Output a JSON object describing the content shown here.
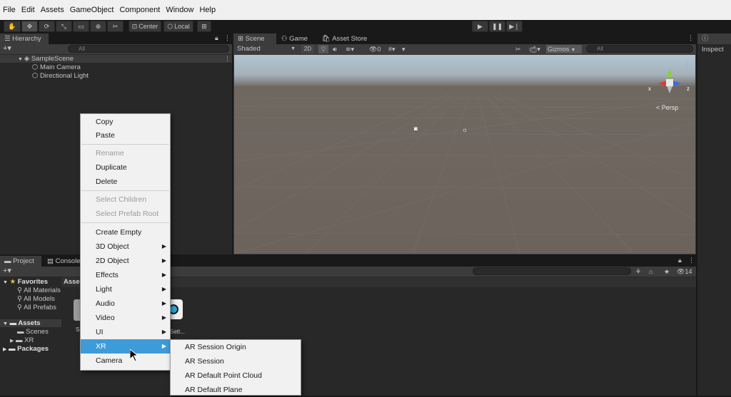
{
  "menubar": [
    "File",
    "Edit",
    "Assets",
    "GameObject",
    "Component",
    "Window",
    "Help"
  ],
  "toolbar": {
    "pivot_label": "Center",
    "space_label": "Local"
  },
  "hierarchy": {
    "tab": "Hierarchy",
    "search_placeholder": "All",
    "scene": "SampleScene",
    "items": [
      "Main Camera",
      "Directional Light"
    ]
  },
  "scene_view": {
    "tabs": [
      "Scene",
      "Game",
      "Asset Store"
    ],
    "shading": "Shaded",
    "mode_2d": "2D",
    "hidden_count": "0",
    "gizmos": "Gizmos",
    "search_placeholder": "All",
    "persp_label": "< Persp",
    "axis_x": "x",
    "axis_z": "z",
    "colors": {
      "sky_top": "#aebfcc",
      "ground": "#6c635c",
      "x_axis": "#e03c2c",
      "y_axis": "#8bd039",
      "z_axis": "#3b6cdf"
    }
  },
  "inspector": {
    "tab": "Inspect"
  },
  "project": {
    "tabs": [
      "Project",
      "Console"
    ],
    "favorites_label": "Favorites",
    "favorites": [
      "All Materials",
      "All Models",
      "All Prefabs"
    ],
    "assets_label": "Assets",
    "asset_folders": [
      "Scenes",
      "XR"
    ],
    "packages_label": "Packages",
    "breadcrumb": "Asse",
    "hidden_packages_count": "14",
    "tile_label_left": "Sc",
    "tile_label_right": "Sett..."
  },
  "context_menu": {
    "items": [
      {
        "label": "Copy"
      },
      {
        "label": "Paste"
      },
      {
        "label": "Rename"
      },
      {
        "label": "Duplicate"
      },
      {
        "label": "Delete"
      },
      {
        "label": "Select Children"
      },
      {
        "label": "Select Prefab Root"
      },
      {
        "label": "Create Empty"
      },
      {
        "label": "3D Object"
      },
      {
        "label": "2D Object"
      },
      {
        "label": "Effects"
      },
      {
        "label": "Light"
      },
      {
        "label": "Audio"
      },
      {
        "label": "Video"
      },
      {
        "label": "UI"
      },
      {
        "label": "XR"
      },
      {
        "label": "Camera"
      }
    ],
    "highlight_color": "#3d9bd9"
  },
  "xr_submenu": {
    "items": [
      "AR Session Origin",
      "AR Session",
      "AR Default Point Cloud",
      "AR Default Plane"
    ]
  }
}
